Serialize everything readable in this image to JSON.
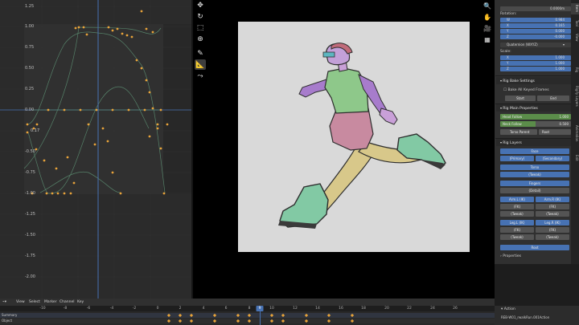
{
  "graph_editor": {
    "y_labels": [
      "1.25",
      "1.00",
      "0.75",
      "0.50",
      "0.25",
      "0.00",
      "-0.25",
      "-0.50",
      "-0.75",
      "-1.00",
      "-1.25",
      "-1.50",
      "-1.75",
      "-2.00"
    ],
    "frame_label": "0.17",
    "colors": {
      "background": "#2b2b2b",
      "curve": "#5a8a6f",
      "keyframe": "#e8a33a",
      "playhead": "#4772b3",
      "zero_line": "#4772b3"
    }
  },
  "header_menu": {
    "view": "View",
    "select": "Select",
    "marker": "Marker",
    "channel": "Channel",
    "key": "Key"
  },
  "timeline": {
    "frame_ticks": [
      "-10",
      "-8",
      "-6",
      "-4",
      "-2",
      "0",
      "2",
      "4",
      "6",
      "8",
      "10",
      "12",
      "14",
      "16",
      "18",
      "20",
      "22",
      "24",
      "26"
    ],
    "current_frame": "9",
    "row_labels": [
      "Summary",
      "Object"
    ]
  },
  "properties": {
    "rotation_label": "Rotation:",
    "rotation": [
      {
        "axis": "W",
        "value": "0.984"
      },
      {
        "axis": "X",
        "value": "0.165"
      },
      {
        "axis": "Y",
        "value": "0.000"
      },
      {
        "axis": "Z",
        "value": "-0.000"
      }
    ],
    "rotation_mode": "Quaternion (WXYZ)",
    "scale_label": "Scale:",
    "scale": [
      {
        "axis": "X",
        "value": "1.000"
      },
      {
        "axis": "Y",
        "value": "1.000"
      },
      {
        "axis": "Z",
        "value": "1.000"
      }
    ],
    "top_value": "0.0000m",
    "rig_bake_settings": "Rig Bake Settings",
    "bake_all_keyed": "Bake All Keyed Frames",
    "start": "Start",
    "end": "End",
    "rig_main_properties": "Rig Main Properties",
    "sliders": [
      {
        "label": "Head Follow",
        "value": "1.000",
        "fill": 1.0
      },
      {
        "label": "Neck Follow",
        "value": "0.500",
        "fill": 0.5
      }
    ],
    "torso_parent": "Torso Parent",
    "torso_parent_value": "Root",
    "rig_layers": "Rig Layers",
    "layers": {
      "face": "Face",
      "primary": "(Primary)",
      "secondary": "(Secondary)",
      "torso": "Torso",
      "tweak1": "(Tweak)",
      "fingers": "Fingers",
      "detail": "(Detail)",
      "arm_l_ik": "Arm.L (IK)",
      "arm_r_ik": "Arm.R (IK)",
      "fk_l": "(FK)",
      "fk_r": "(FK)",
      "tweak_l": "(Tweak)",
      "tweak_r": "(Tweak)",
      "leg_l_ik": "Leg.L (IK)",
      "leg_r_ik": "Leg.R (IK)",
      "fk2_l": "(FK)",
      "fk2_r": "(FK)",
      "tweak2_l": "(Tweak)",
      "tweak2_r": "(Tweak)",
      "root": "Root"
    },
    "footer_label": "Properties"
  },
  "sidebar_tabs": [
    "Item",
    "Tool",
    "View",
    "Rig",
    "Rigify Layers",
    "Animation",
    "Edit"
  ],
  "action_panel": {
    "title": "Action",
    "name": "REB-W01_rwalkRun.001Action"
  },
  "viewport": {
    "camera_bg": "#d9d9d9"
  }
}
